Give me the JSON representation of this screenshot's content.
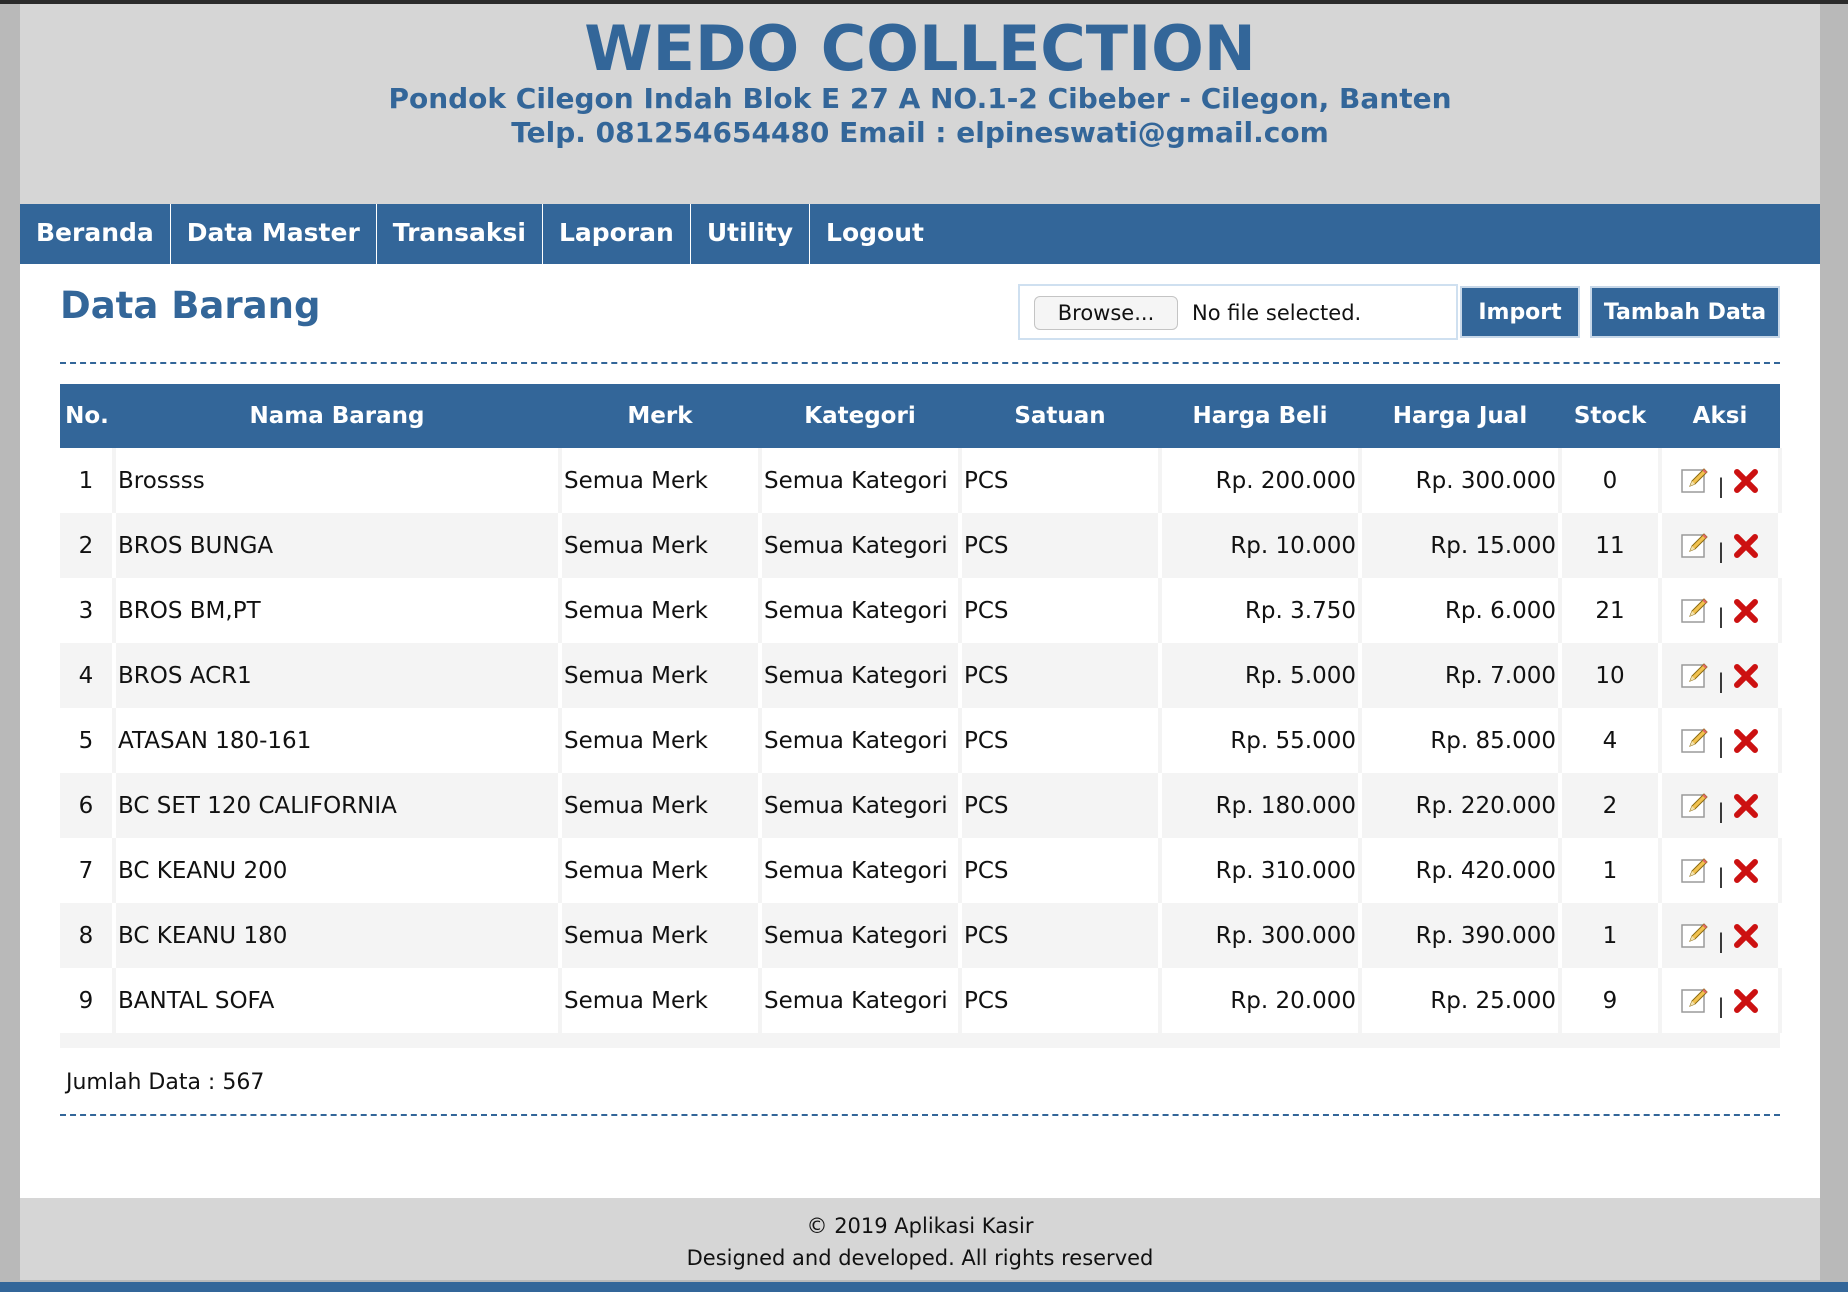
{
  "header": {
    "brand": "WEDO COLLECTION",
    "address": "Pondok Cilegon Indah Blok E 27 A NO.1-2 Cibeber - Cilegon, Banten",
    "contact": "Telp. 081254654480 Email : elpineswati@gmail.com"
  },
  "nav": {
    "items": [
      {
        "label": "Beranda"
      },
      {
        "label": "Data Master"
      },
      {
        "label": "Transaksi"
      },
      {
        "label": "Laporan"
      },
      {
        "label": "Utility"
      },
      {
        "label": "Logout"
      }
    ]
  },
  "content": {
    "title": "Data Barang",
    "browse_label": "Browse...",
    "file_status": "No file selected.",
    "import_label": "Import",
    "add_label": "Tambah Data",
    "total_text": "Jumlah Data : 567"
  },
  "table": {
    "headers": [
      "No.",
      "Nama Barang",
      "Merk",
      "Kategori",
      "Satuan",
      "Harga Beli",
      "Harga Jual",
      "Stock",
      "Aksi"
    ],
    "rows": [
      {
        "no": "1",
        "nama": "Brossss",
        "merk": "Semua Merk",
        "kategori": "Semua Kategori",
        "satuan": "PCS",
        "beli": "Rp. 200.000",
        "jual": "Rp. 300.000",
        "stock": "0"
      },
      {
        "no": "2",
        "nama": "BROS BUNGA",
        "merk": "Semua Merk",
        "kategori": "Semua Kategori",
        "satuan": "PCS",
        "beli": "Rp. 10.000",
        "jual": "Rp. 15.000",
        "stock": "11"
      },
      {
        "no": "3",
        "nama": "BROS BM,PT",
        "merk": "Semua Merk",
        "kategori": "Semua Kategori",
        "satuan": "PCS",
        "beli": "Rp. 3.750",
        "jual": "Rp. 6.000",
        "stock": "21"
      },
      {
        "no": "4",
        "nama": "BROS ACR1",
        "merk": "Semua Merk",
        "kategori": "Semua Kategori",
        "satuan": "PCS",
        "beli": "Rp. 5.000",
        "jual": "Rp. 7.000",
        "stock": "10"
      },
      {
        "no": "5",
        "nama": "ATASAN 180-161",
        "merk": "Semua Merk",
        "kategori": "Semua Kategori",
        "satuan": "PCS",
        "beli": "Rp. 55.000",
        "jual": "Rp. 85.000",
        "stock": "4"
      },
      {
        "no": "6",
        "nama": "BC SET 120 CALIFORNIA",
        "merk": "Semua Merk",
        "kategori": "Semua Kategori",
        "satuan": "PCS",
        "beli": "Rp. 180.000",
        "jual": "Rp. 220.000",
        "stock": "2"
      },
      {
        "no": "7",
        "nama": "BC KEANU 200",
        "merk": "Semua Merk",
        "kategori": "Semua Kategori",
        "satuan": "PCS",
        "beli": "Rp. 310.000",
        "jual": "Rp. 420.000",
        "stock": "1"
      },
      {
        "no": "8",
        "nama": "BC KEANU 180",
        "merk": "Semua Merk",
        "kategori": "Semua Kategori",
        "satuan": "PCS",
        "beli": "Rp. 300.000",
        "jual": "Rp. 390.000",
        "stock": "1"
      },
      {
        "no": "9",
        "nama": "BANTAL SOFA",
        "merk": "Semua Merk",
        "kategori": "Semua Kategori",
        "satuan": "PCS",
        "beli": "Rp. 20.000",
        "jual": "Rp. 25.000",
        "stock": "9"
      }
    ],
    "action_separator": "|"
  },
  "footer": {
    "line1": "© 2019 Aplikasi Kasir",
    "line2": "Designed and developed. All rights reserved"
  },
  "icons": {
    "edit": "pencil-edit-icon",
    "delete": "red-x-delete-icon"
  },
  "colors": {
    "primary": "#336699",
    "header_bg": "#d6d6d6",
    "delete_red": "#cc1111"
  }
}
